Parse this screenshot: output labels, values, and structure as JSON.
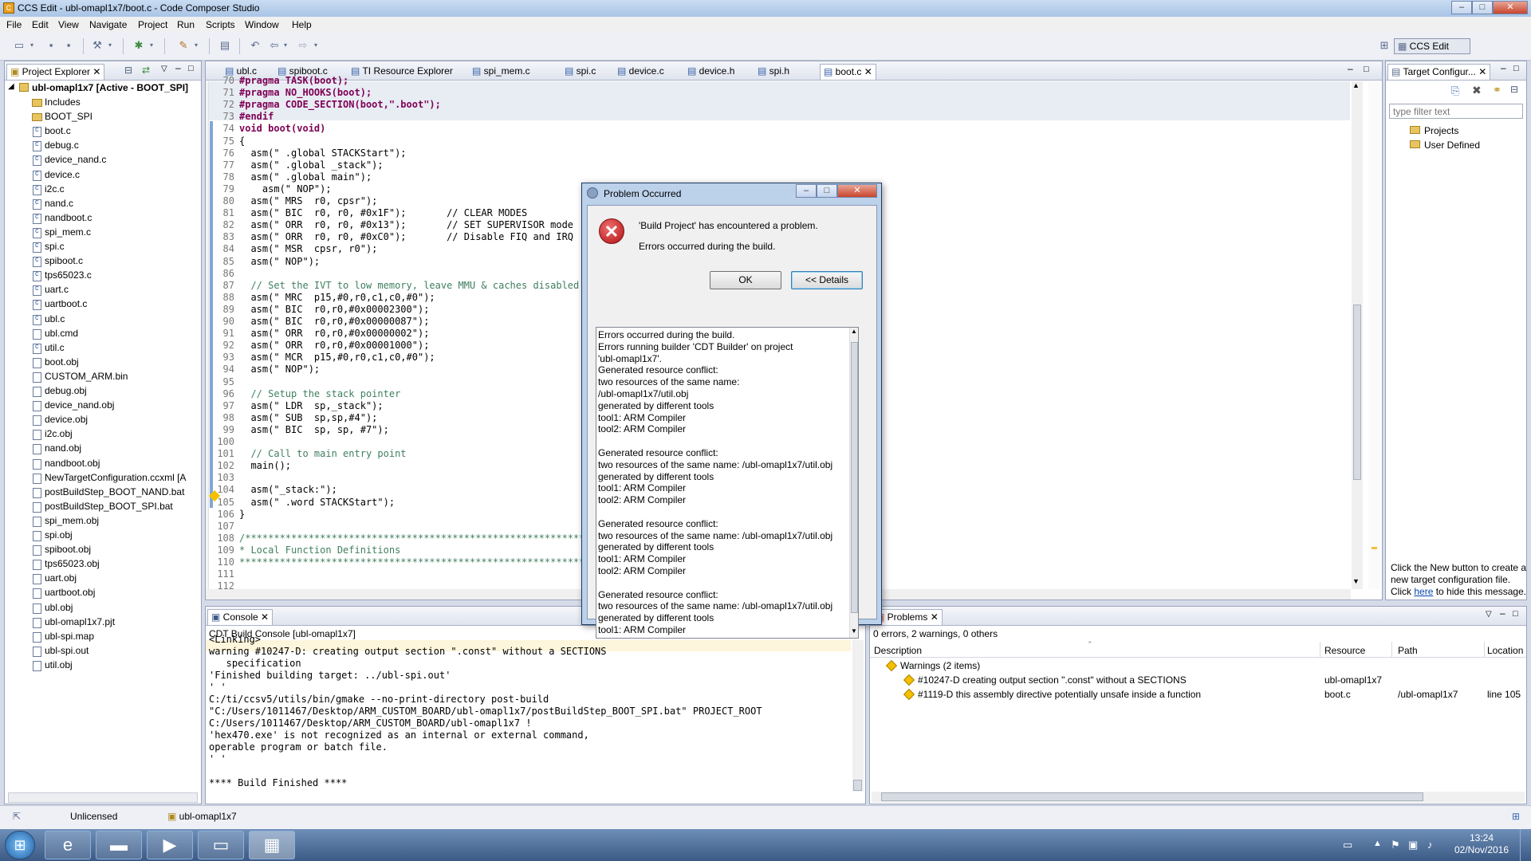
{
  "window": {
    "title": "CCS Edit - ubl-omapl1x7/boot.c - Code Composer Studio"
  },
  "menu": [
    "File",
    "Edit",
    "View",
    "Navigate",
    "Project",
    "Run",
    "Scripts",
    "Window",
    "Help"
  ],
  "perspective": "CCS Edit",
  "project_explorer": {
    "tab": "Project Explorer",
    "root": "ubl-omapl1x7  [Active - BOOT_SPI]",
    "items": [
      "Includes",
      "BOOT_SPI",
      "boot.c",
      "debug.c",
      "device_nand.c",
      "device.c",
      "i2c.c",
      "nand.c",
      "nandboot.c",
      "spi_mem.c",
      "spi.c",
      "spiboot.c",
      "tps65023.c",
      "uart.c",
      "uartboot.c",
      "ubl.c",
      "ubl.cmd",
      "util.c",
      "boot.obj",
      "CUSTOM_ARM.bin",
      "debug.obj",
      "device_nand.obj",
      "device.obj",
      "i2c.obj",
      "nand.obj",
      "nandboot.obj",
      "NewTargetConfiguration.ccxml [A",
      "postBuildStep_BOOT_NAND.bat",
      "postBuildStep_BOOT_SPI.bat",
      "spi_mem.obj",
      "spi.obj",
      "spiboot.obj",
      "tps65023.obj",
      "uart.obj",
      "uartboot.obj",
      "ubl.obj",
      "ubl-omapl1x7.pjt",
      "ubl-spi.map",
      "ubl-spi.out",
      "util.obj"
    ]
  },
  "editor_tabs": [
    "ubl.c",
    "spiboot.c",
    "TI Resource Explorer",
    "spi_mem.c",
    "spi.c",
    "device.c",
    "device.h",
    "spi.h",
    "boot.c"
  ],
  "code_lines": [
    {
      "n": "70",
      "t": "#pragma TASK(boot);"
    },
    {
      "n": "71",
      "t": "#pragma NO_HOOKS(boot);"
    },
    {
      "n": "72",
      "t": "#pragma CODE_SECTION(boot,\".boot\");"
    },
    {
      "n": "73",
      "t": "#endif"
    },
    {
      "n": "74",
      "t": "void boot(void)"
    },
    {
      "n": "75",
      "t": "{"
    },
    {
      "n": "76",
      "t": "  asm(\" .global STACKStart\");"
    },
    {
      "n": "77",
      "t": "  asm(\" .global _stack\");"
    },
    {
      "n": "78",
      "t": "  asm(\" .global main\");"
    },
    {
      "n": "79",
      "t": "    asm(\" NOP\");"
    },
    {
      "n": "80",
      "t": "  asm(\" MRS  r0, cpsr\");"
    },
    {
      "n": "81",
      "t": "  asm(\" BIC  r0, r0, #0x1F\");       // CLEAR MODES"
    },
    {
      "n": "82",
      "t": "  asm(\" ORR  r0, r0, #0x13\");       // SET SUPERVISOR mode"
    },
    {
      "n": "83",
      "t": "  asm(\" ORR  r0, r0, #0xC0\");       // Disable FIQ and IRQ"
    },
    {
      "n": "84",
      "t": "  asm(\" MSR  cpsr, r0\");"
    },
    {
      "n": "85",
      "t": "  asm(\" NOP\");"
    },
    {
      "n": "86",
      "t": ""
    },
    {
      "n": "87",
      "t": "  // Set the IVT to low memory, leave MMU & caches disabled"
    },
    {
      "n": "88",
      "t": "  asm(\" MRC  p15,#0,r0,c1,c0,#0\");"
    },
    {
      "n": "89",
      "t": "  asm(\" BIC  r0,r0,#0x00002300\");"
    },
    {
      "n": "90",
      "t": "  asm(\" BIC  r0,r0,#0x00000087\");"
    },
    {
      "n": "91",
      "t": "  asm(\" ORR  r0,r0,#0x00000002\");"
    },
    {
      "n": "92",
      "t": "  asm(\" ORR  r0,r0,#0x00001000\");"
    },
    {
      "n": "93",
      "t": "  asm(\" MCR  p15,#0,r0,c1,c0,#0\");"
    },
    {
      "n": "94",
      "t": "  asm(\" NOP\");"
    },
    {
      "n": "95",
      "t": ""
    },
    {
      "n": "96",
      "t": "  // Setup the stack pointer"
    },
    {
      "n": "97",
      "t": "  asm(\" LDR  sp,_stack\");"
    },
    {
      "n": "98",
      "t": "  asm(\" SUB  sp,sp,#4\");"
    },
    {
      "n": "99",
      "t": "  asm(\" BIC  sp, sp, #7\");"
    },
    {
      "n": "100",
      "t": ""
    },
    {
      "n": "101",
      "t": "  // Call to main entry point"
    },
    {
      "n": "102",
      "t": "  main();"
    },
    {
      "n": "103",
      "t": ""
    },
    {
      "n": "104",
      "t": "  asm(\"_stack:\");"
    },
    {
      "n": "105",
      "t": "  asm(\" .word STACKStart\");"
    },
    {
      "n": "106",
      "t": "}"
    },
    {
      "n": "107",
      "t": ""
    },
    {
      "n": "108",
      "t": "/*******************************************************************"
    },
    {
      "n": "109",
      "t": "* Local Function Definitions                                       *"
    },
    {
      "n": "110",
      "t": "*******************************************************************/"
    },
    {
      "n": "111",
      "t": ""
    },
    {
      "n": "112",
      "t": ""
    }
  ],
  "dialog": {
    "title": "Problem Occurred",
    "message": "'Build Project' has encountered a problem.",
    "sub": "Errors occurred during the build.",
    "ok": "OK",
    "details_btn": "<< Details",
    "details": [
      "Errors occurred during the build.",
      "    Errors running builder 'CDT Builder' on project",
      "    'ubl-omapl1x7'.",
      "        Generated resource conflict:",
      "        two resources of the same name:",
      "      /ubl-omapl1x7/util.obj",
      "    generated by different tools",
      "    tool1: ARM Compiler",
      "tool2: ARM Compiler",
      "",
      "Generated resource conflict:",
      "two resources of the same name: /ubl-omapl1x7/util.obj",
      "generated by different tools",
      "tool1: ARM Compiler",
      "tool2: ARM Compiler",
      "",
      "Generated resource conflict:",
      "two resources of the same name: /ubl-omapl1x7/util.obj",
      "generated by different tools",
      "tool1: ARM Compiler",
      "tool2: ARM Compiler",
      "",
      "Generated resource conflict:",
      "two resources of the same name: /ubl-omapl1x7/util.obj",
      "generated by different tools",
      "tool1: ARM Compiler"
    ]
  },
  "target_config": {
    "tab": "Target Configur...",
    "filter_placeholder": "type filter text",
    "items": [
      "Projects",
      "User Defined"
    ],
    "hint": [
      "Click the New button to create a",
      "new target configuration file.",
      "Click",
      "here",
      "to hide this message."
    ]
  },
  "console": {
    "tab": "Console",
    "header": "CDT Build Console [ubl-omapl1x7]",
    "lines": [
      "<Linking>",
      "warning #10247-D: creating output section \".const\" without a SECTIONS",
      "   specification",
      "'Finished building target: ../ubl-spi.out'",
      "' '",
      "C:/ti/ccsv5/utils/bin/gmake --no-print-directory post-build",
      "\"C:/Users/1011467/Desktop/ARM_CUSTOM_BOARD/ubl-omapl1x7/postBuildStep_BOOT_SPI.bat\" PROJECT_ROOT",
      "C:/Users/1011467/Desktop/ARM_CUSTOM_BOARD/ubl-omapl1x7 !",
      "'hex470.exe' is not recognized as an internal or external command,",
      "operable program or batch file.",
      "' '",
      "",
      "**** Build Finished ****"
    ]
  },
  "problems": {
    "tab": "Problems",
    "summary": "0 errors, 2 warnings, 0 others",
    "columns": [
      "Description",
      "Resource",
      "Path",
      "Location"
    ],
    "group": "Warnings (2 items)",
    "rows": [
      {
        "desc": "#10247-D creating output section \".const\" without a SECTIONS",
        "resource": "ubl-omapl1x7",
        "path": "",
        "location": ""
      },
      {
        "desc": "#1119-D this assembly directive potentially unsafe inside a function",
        "resource": "boot.c",
        "path": "/ubl-omapl1x7",
        "location": "line 105"
      }
    ]
  },
  "status": {
    "license": "Unlicensed",
    "project": "ubl-omapl1x7"
  },
  "clock": {
    "time": "13:24",
    "date": "02/Nov/2016"
  }
}
